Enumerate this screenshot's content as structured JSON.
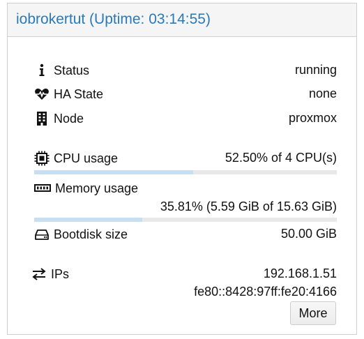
{
  "header": {
    "title": "iobrokertut (Uptime: 03:14:55)"
  },
  "rows": {
    "status": {
      "label": "Status",
      "value": "running",
      "icon": "info-icon"
    },
    "ha_state": {
      "label": "HA State",
      "value": "none",
      "icon": "heartbeat-icon"
    },
    "node": {
      "label": "Node",
      "value": "proxmox",
      "icon": "building-icon"
    },
    "cpu": {
      "label": "CPU usage",
      "value": "52.50% of 4 CPU(s)",
      "icon": "cpu-chip-icon",
      "fraction": 0.525
    },
    "memory": {
      "label": "Memory usage",
      "value": "35.81% (5.59 GiB of 15.63 GiB)",
      "icon": "memory-icon",
      "fraction": 0.3581
    },
    "bootdisk": {
      "label": "Bootdisk size",
      "value": "50.00 GiB",
      "icon": "hdd-icon"
    },
    "ips": {
      "label": "IPs",
      "ipv4": "192.168.1.51",
      "ipv6": "fe80::8428:97ff:fe20:4166",
      "icon": "exchange-arrows-icon"
    }
  },
  "buttons": {
    "more_label": "More"
  },
  "colors": {
    "title": "#2a7ab8",
    "bar_fill": "#c7dff0",
    "bar_track": "#e8e8e8"
  }
}
